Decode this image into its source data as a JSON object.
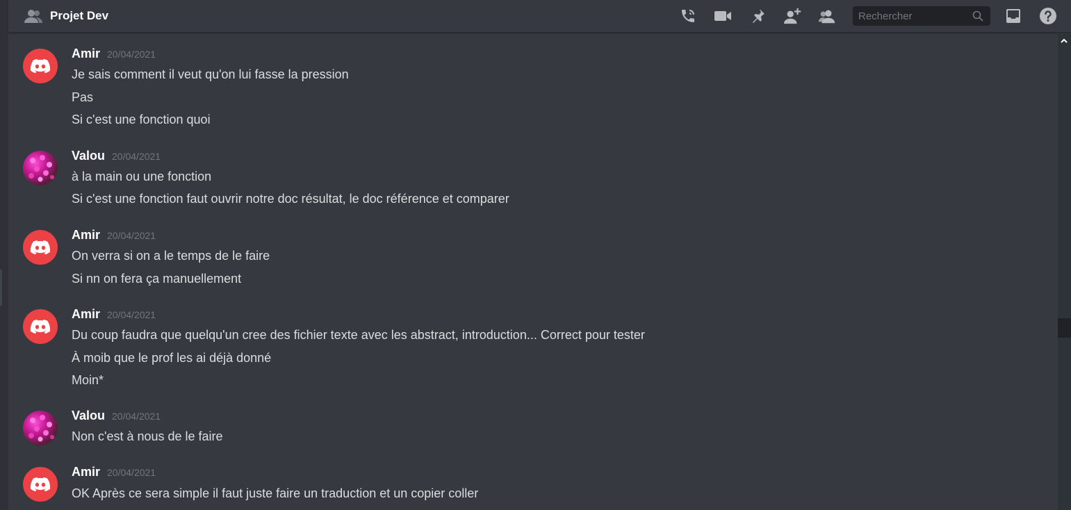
{
  "channel": {
    "title": "Projet Dev"
  },
  "search": {
    "placeholder": "Rechercher"
  },
  "messages": [
    {
      "author": "Amir",
      "date": "20/04/2021",
      "avatar": "discord-avatar",
      "lines": [
        "Je sais comment il veut qu'on lui fasse la pression",
        "Pas",
        "Si c'est une fonction quoi"
      ]
    },
    {
      "author": "Valou",
      "date": "20/04/2021",
      "avatar": "flower-avatar",
      "lines": [
        "à la main ou une fonction",
        "Si c'est une fonction faut ouvrir notre doc résultat, le doc référence et comparer"
      ]
    },
    {
      "author": "Amir",
      "date": "20/04/2021",
      "avatar": "discord-avatar",
      "lines": [
        "On verra si on a le temps de le faire",
        "Si nn on fera ça manuellement"
      ]
    },
    {
      "author": "Amir",
      "date": "20/04/2021",
      "avatar": "discord-avatar",
      "lines": [
        "Du coup faudra que quelqu'un cree des fichier texte avec les abstract, introduction... Correct pour tester",
        "À moib que le prof les ai déjà donné",
        "Moin*"
      ]
    },
    {
      "author": "Valou",
      "date": "20/04/2021",
      "avatar": "flower-avatar",
      "lines": [
        "Non c'est à nous de le faire"
      ]
    },
    {
      "author": "Amir",
      "date": "20/04/2021",
      "avatar": "discord-avatar",
      "lines": [
        "OK Après ce sera simple il faut juste faire un traduction et un copier coller"
      ]
    }
  ],
  "toolbar_icons": [
    "phone-call-icon",
    "video-icon",
    "pin-icon",
    "add-member-icon",
    "members-icon",
    "inbox-icon",
    "help-icon"
  ],
  "colors": {
    "background": "#36393f",
    "discord_red": "#ed4245",
    "text": "#dcddde",
    "muted": "#72767d"
  }
}
